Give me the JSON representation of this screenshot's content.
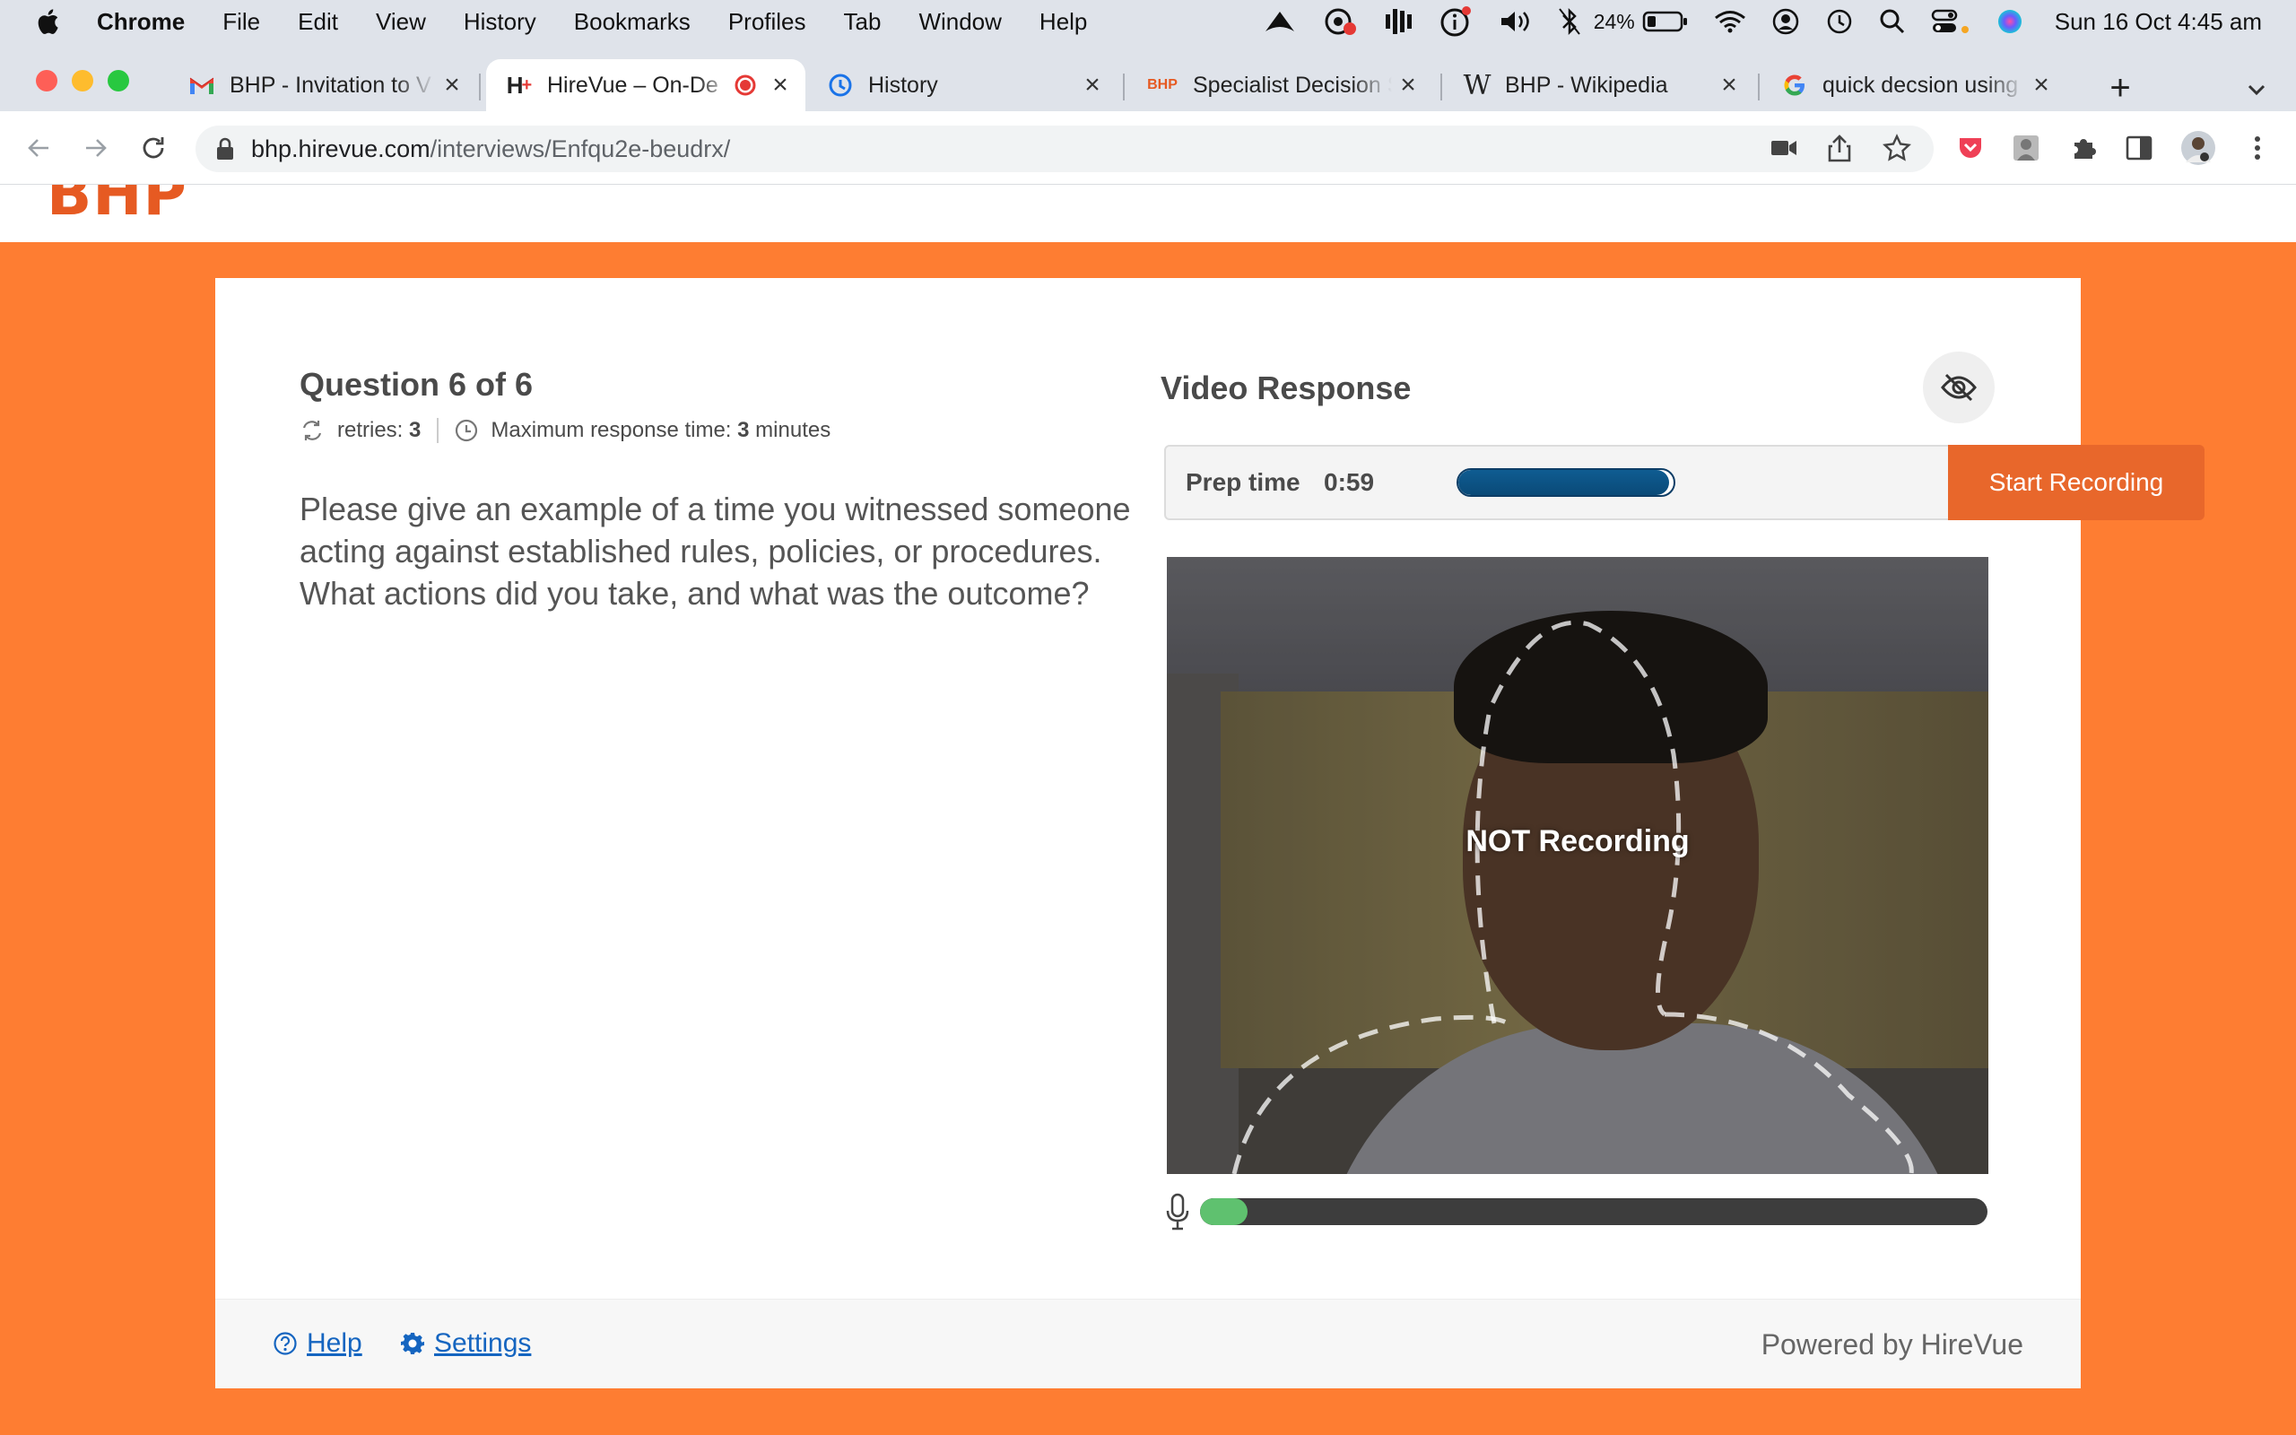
{
  "menubar": {
    "app": "Chrome",
    "items": [
      "File",
      "Edit",
      "View",
      "History",
      "Bookmarks",
      "Profiles",
      "Tab",
      "Window",
      "Help"
    ],
    "battery": "24%",
    "clock": "Sun 16 Oct  4:45 am"
  },
  "tabs": [
    {
      "title": "BHP - Invitation to V",
      "favicon": "gmail-icon"
    },
    {
      "title": "HireVue – On-De",
      "favicon": "hirevue-icon",
      "recording": true
    },
    {
      "title": "History",
      "favicon": "history-icon"
    },
    {
      "title": "Specialist Decision S",
      "favicon": "bhp-icon"
    },
    {
      "title": "BHP - Wikipedia",
      "favicon": "wikipedia-icon"
    },
    {
      "title": "quick decsion using",
      "favicon": "google-icon"
    }
  ],
  "omnibox": {
    "host": "bhp.hirevue.com",
    "path": "/interviews/Enfqu2e-beudrx/"
  },
  "page": {
    "logo": "BHP",
    "question": {
      "title": "Question 6 of 6",
      "retries_label": "retries:",
      "retries_value": "3",
      "max_time_label": "Maximum response time:",
      "max_time_value": "3",
      "max_time_unit": "minutes",
      "text": "Please give an example of a time you witnessed someone acting against established rules, policies, or procedures. What actions did you take, and what was the outcome?"
    },
    "video": {
      "title": "Video Response",
      "prep_label": "Prep time",
      "prep_time": "0:59",
      "prep_progress": 0.98,
      "start_button": "Start Recording",
      "status": "NOT Recording",
      "mic_level": 0.06
    },
    "footer": {
      "help": "Help",
      "settings": "Settings",
      "powered_by": "Powered by HireVue"
    }
  },
  "colors": {
    "page_bg": "#fe7d32",
    "accent": "#e8672b",
    "link": "#1565c0",
    "prep_fill": "#0f5c91",
    "mic_fill": "#5fc16f"
  }
}
